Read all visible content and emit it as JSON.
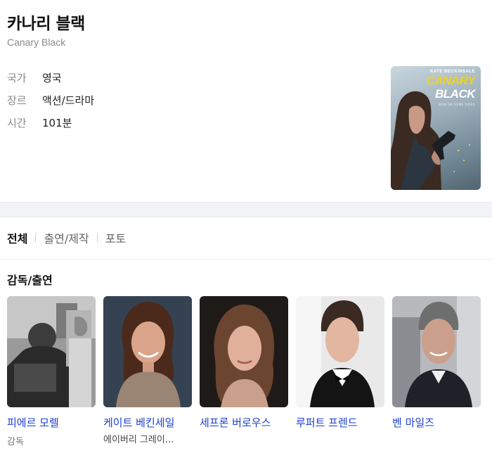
{
  "movie": {
    "title": "카나리 블랙",
    "original_title": "Canary Black",
    "meta": [
      {
        "key": "국가",
        "value": "영국"
      },
      {
        "key": "장르",
        "value": "액션/드라마"
      },
      {
        "key": "시간",
        "value": "101분"
      }
    ],
    "poster": {
      "actor_text": "KATE BECKINSALE",
      "title_line1": "CANARY",
      "title_line2": "BLACK",
      "tagline": "NOW ON PRIME VIDEO"
    }
  },
  "tabs": [
    {
      "label": "전체",
      "active": true
    },
    {
      "label": "출연/제작",
      "active": false
    },
    {
      "label": "포토",
      "active": false
    }
  ],
  "cast_section": {
    "title": "감독/출연",
    "people": [
      {
        "name": "피에르 모렐",
        "role": "감독",
        "extra": ""
      },
      {
        "name": "케이트 베킨세일",
        "role": "",
        "extra": "에이버리 그레이..."
      },
      {
        "name": "세프론 버로우스",
        "role": "",
        "extra": ""
      },
      {
        "name": "루퍼트 프렌드",
        "role": "",
        "extra": ""
      },
      {
        "name": "벤 마일즈",
        "role": "",
        "extra": ""
      }
    ]
  },
  "colors": {
    "link": "#1a3fd0",
    "muted": "#888888",
    "poster_title": "#f2d21c"
  }
}
